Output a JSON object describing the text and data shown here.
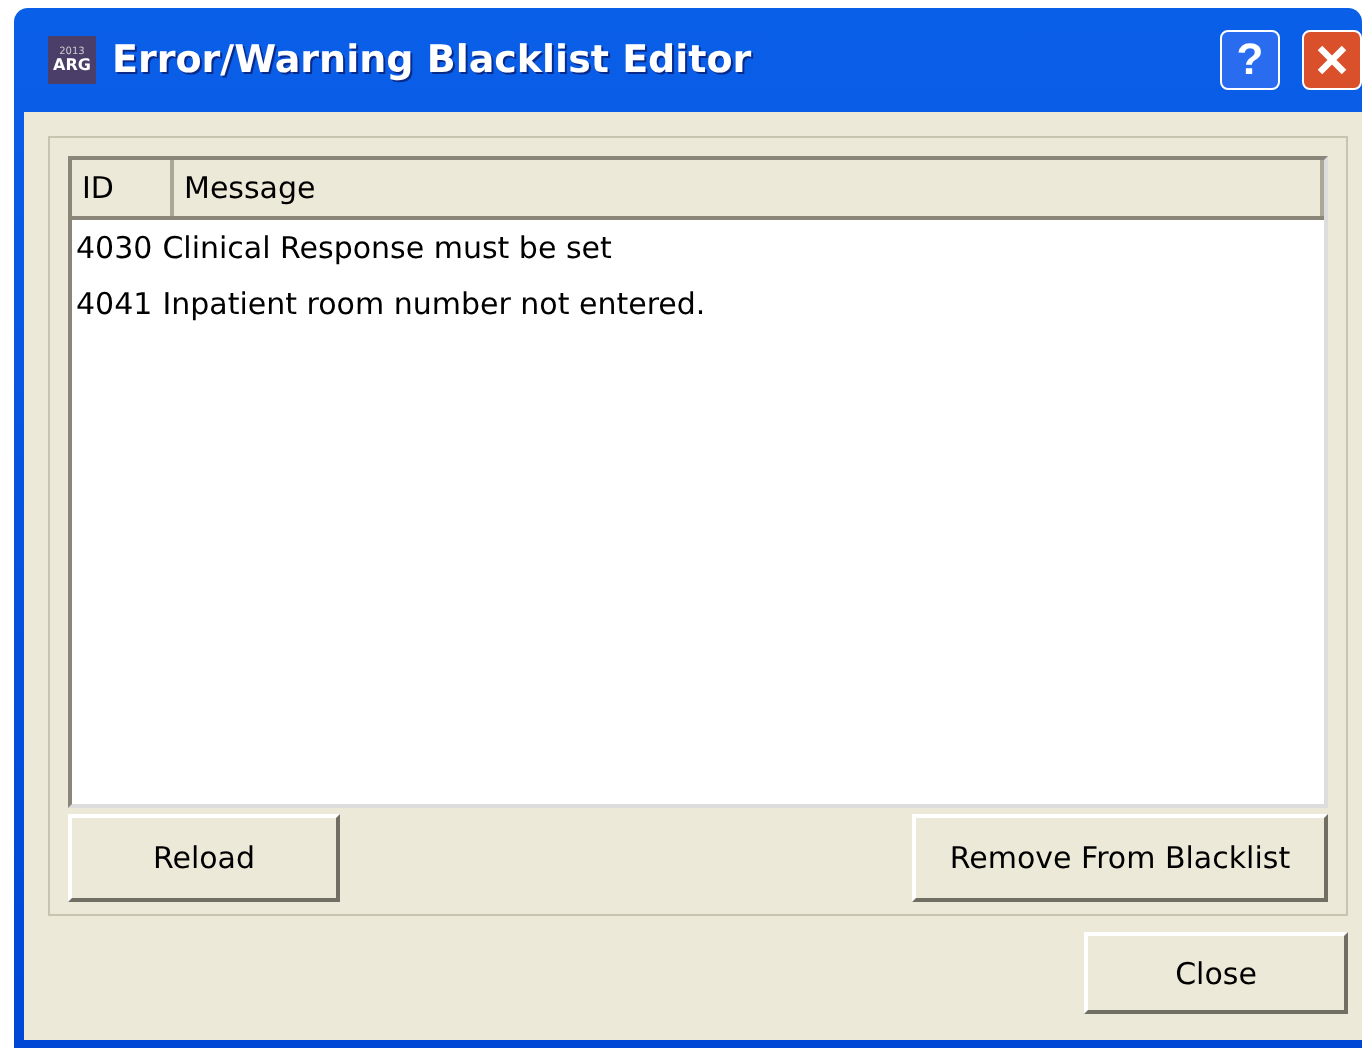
{
  "window": {
    "title": "Error/Warning Blacklist Editor",
    "icon_year": "2013",
    "icon_text": "ARG",
    "help": "?"
  },
  "table": {
    "columns": [
      "ID",
      "Message"
    ],
    "rows": [
      {
        "id": "4030",
        "message": "Clinical Response must be set"
      },
      {
        "id": "4041",
        "message": "Inpatient room number not entered."
      }
    ]
  },
  "buttons": {
    "reload": "Reload",
    "remove": "Remove From Blacklist",
    "close": "Close"
  }
}
